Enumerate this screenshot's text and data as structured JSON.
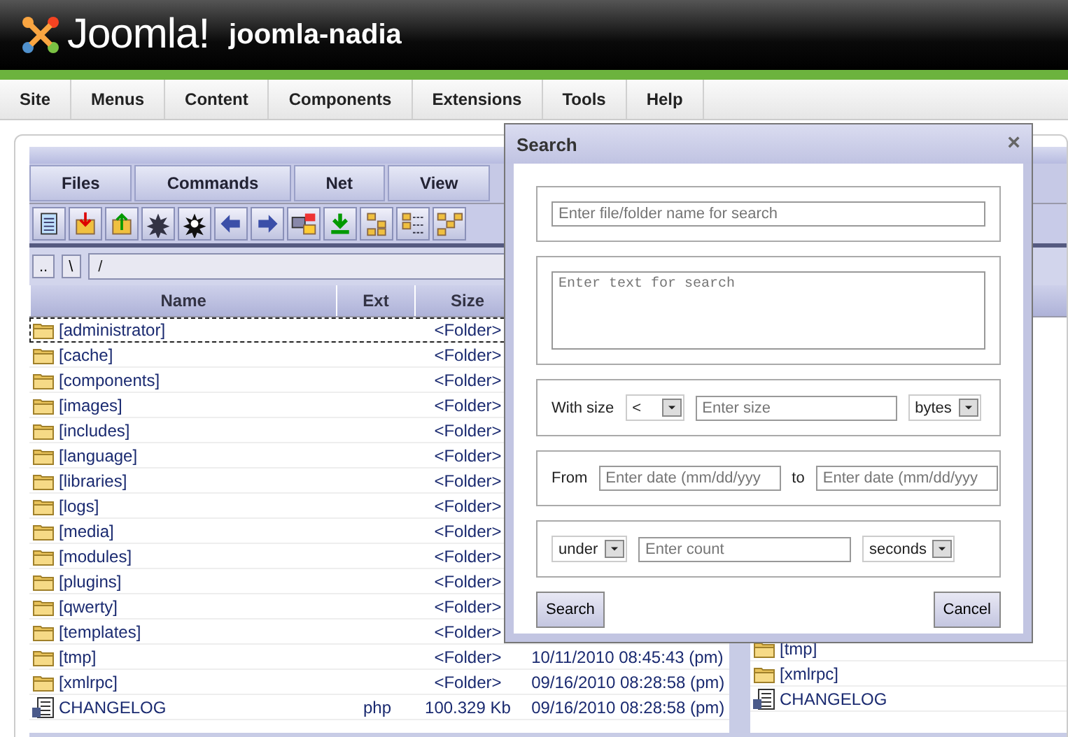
{
  "header": {
    "logo": "Joomla!",
    "site_name": "joomla-nadia"
  },
  "menu": [
    {
      "label": "Site"
    },
    {
      "label": "Menus"
    },
    {
      "label": "Content"
    },
    {
      "label": "Components"
    },
    {
      "label": "Extensions"
    },
    {
      "label": "Tools"
    },
    {
      "label": "Help"
    }
  ],
  "file_manager": {
    "menu": [
      "Files",
      "Commands",
      "Net",
      "View"
    ],
    "path": {
      "buttons": [
        "..",
        "\\"
      ],
      "value": "/"
    },
    "columns": [
      "Name",
      "Ext",
      "Size"
    ],
    "rows": [
      {
        "kind": "folder",
        "name": "[administrator]",
        "size": "<Folder>",
        "selected": true
      },
      {
        "kind": "folder",
        "name": "[cache]",
        "size": "<Folder>",
        "selected": false
      },
      {
        "kind": "folder",
        "name": "[components]",
        "size": "<Folder>",
        "selected": false
      },
      {
        "kind": "folder",
        "name": "[images]",
        "size": "<Folder>",
        "selected": false
      },
      {
        "kind": "folder",
        "name": "[includes]",
        "size": "<Folder>",
        "selected": false
      },
      {
        "kind": "folder",
        "name": "[language]",
        "size": "<Folder>",
        "selected": false
      },
      {
        "kind": "folder",
        "name": "[libraries]",
        "size": "<Folder>",
        "selected": false
      },
      {
        "kind": "folder",
        "name": "[logs]",
        "size": "<Folder>",
        "selected": false
      },
      {
        "kind": "folder",
        "name": "[media]",
        "size": "<Folder>",
        "selected": false
      },
      {
        "kind": "folder",
        "name": "[modules]",
        "size": "<Folder>",
        "selected": false
      },
      {
        "kind": "folder",
        "name": "[plugins]",
        "size": "<Folder>",
        "selected": false
      },
      {
        "kind": "folder",
        "name": "[qwerty]",
        "size": "<Folder>",
        "selected": false
      },
      {
        "kind": "folder",
        "name": "[templates]",
        "size": "<Folder>",
        "selected": false
      },
      {
        "kind": "folder",
        "name": "[tmp]",
        "size": "<Folder>",
        "date": "10/11/2010 08:45:43 (pm)",
        "selected": false
      },
      {
        "kind": "folder",
        "name": "[xmlrpc]",
        "size": "<Folder>",
        "date": "09/16/2010 08:28:58 (pm)",
        "selected": false
      },
      {
        "kind": "file",
        "name": "CHANGELOG",
        "ext": "php",
        "size": "100.329 Kb",
        "date": "09/16/2010 08:28:58 (pm)",
        "selected": false
      }
    ],
    "right_rows": [
      {
        "kind": "folder",
        "name": "[tmp]"
      },
      {
        "kind": "folder",
        "name": "[xmlrpc]"
      },
      {
        "kind": "file",
        "name": "CHANGELOG"
      }
    ]
  },
  "dialog": {
    "title": "Search",
    "close": "×",
    "name_placeholder": "Enter file/folder name for search",
    "text_placeholder": "Enter text for search",
    "size_label": "With size",
    "size_operator": "<",
    "size_placeholder": "Enter size",
    "size_unit": "bytes",
    "from_label": "From",
    "from_placeholder": "Enter date (mm/dd/yyy",
    "to_label": "to",
    "to_placeholder": "Enter date (mm/dd/yyy",
    "age_operator": "under",
    "count_placeholder": "Enter count",
    "age_unit": "seconds",
    "search_button": "Search",
    "cancel_button": "Cancel"
  }
}
